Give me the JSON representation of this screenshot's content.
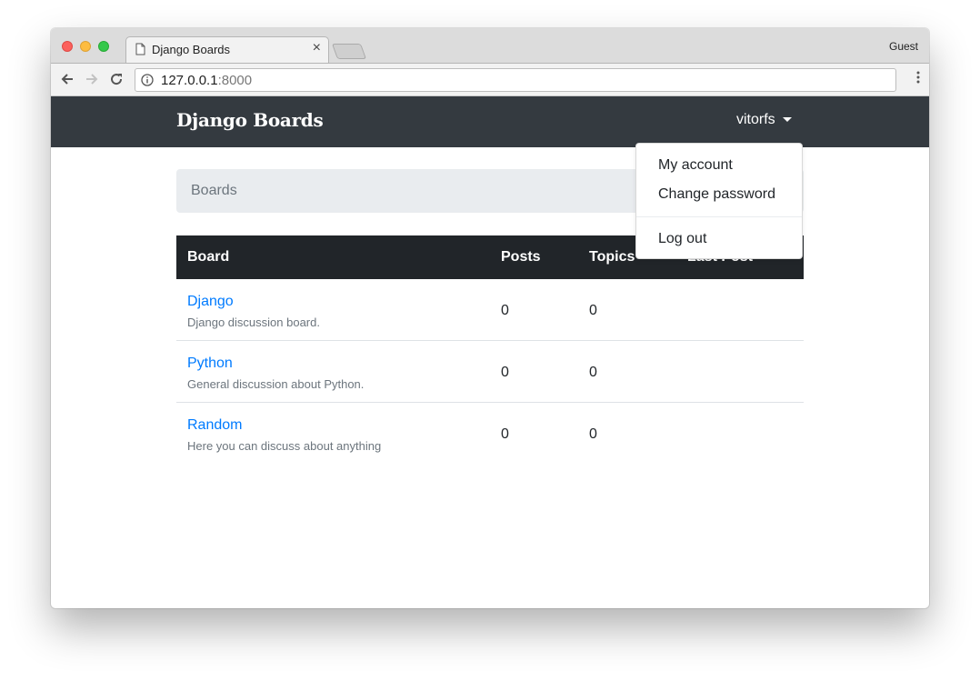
{
  "browser": {
    "tab_title": "Django Boards",
    "tab_close": "×",
    "profile": "Guest",
    "url_host": "127.0.0.1",
    "url_port": ":8000"
  },
  "navbar": {
    "brand": "Django Boards",
    "username": "vitorfs"
  },
  "user_menu": {
    "items": [
      "My account",
      "Change password",
      "Log out"
    ]
  },
  "breadcrumb": {
    "current": "Boards"
  },
  "table": {
    "headers": [
      "Board",
      "Posts",
      "Topics",
      "Last Post"
    ],
    "rows": [
      {
        "name": "Django",
        "description": "Django discussion board.",
        "posts": "0",
        "topics": "0"
      },
      {
        "name": "Python",
        "description": "General discussion about Python.",
        "posts": "0",
        "topics": "0"
      },
      {
        "name": "Random",
        "description": "Here you can discuss about anything",
        "posts": "0",
        "topics": "0"
      }
    ]
  },
  "colors": {
    "navbar_bg": "#343a40",
    "table_header_bg": "#212529",
    "link": "#007bff",
    "breadcrumb_bg": "#e9ecef",
    "muted": "#6c757d"
  }
}
